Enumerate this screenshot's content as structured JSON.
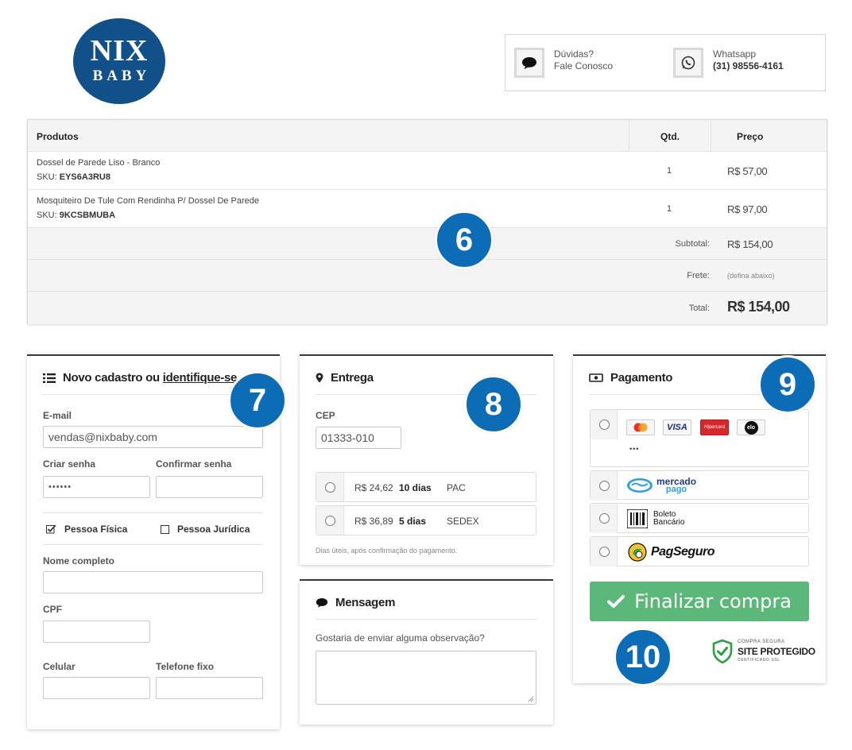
{
  "logo": {
    "line1": "NIX",
    "line2": "BABY"
  },
  "header": {
    "contact": {
      "line1": "Dúvidas?",
      "line2": "Fale Conosco",
      "icon": "chat-bubble-icon"
    },
    "whatsapp": {
      "line1": "Whatsapp",
      "line2": "(31) 98556-4161",
      "icon": "whatsapp-icon"
    }
  },
  "products": {
    "headers": {
      "product": "Produtos",
      "qty": "Qtd.",
      "price": "Preço"
    },
    "rows": [
      {
        "name": "Dossel de Parede Liso - Branco",
        "sku_label": "SKU:",
        "sku": "EYS6A3RU8",
        "qty": "1",
        "price": "R$ 57,00"
      },
      {
        "name": "Mosquiteiro De Tule Com Rendinha P/ Dossel De Parede",
        "sku_label": "SKU:",
        "sku": "9KCSBMUBA",
        "qty": "1",
        "price": "R$ 97,00"
      }
    ],
    "subtotal_label": "Subtotal:",
    "subtotal_value": "R$ 154,00",
    "frete_label": "Frete:",
    "frete_value": "(defina abaixo)",
    "total_label": "Total:",
    "total_value": "R$ 154,00"
  },
  "badges": {
    "b6": "6",
    "b7": "7",
    "b8": "8",
    "b9": "9",
    "b10": "10"
  },
  "cadastro": {
    "title_prefix": "Novo cadastro ou",
    "title_link": "identifique-se",
    "email_label": "E-mail",
    "email_value": "vendas@nixbaby.com",
    "senha_label": "Criar senha",
    "senha_value": "••••••",
    "confirmar_label": "Confirmar senha",
    "pessoa_fisica": "Pessoa Física",
    "pessoa_juridica": "Pessoa Jurídica",
    "nome_label": "Nome completo",
    "cpf_label": "CPF",
    "celular_label": "Celular",
    "telefone_label": "Telefone fixo"
  },
  "entrega": {
    "title": "Entrega",
    "cep_label": "CEP",
    "cep_value": "01333-010",
    "options": [
      {
        "price": "R$ 24,62",
        "days": "10 dias",
        "service": "PAC"
      },
      {
        "price": "R$ 36,89",
        "days": "5 dias",
        "service": "SEDEX"
      }
    ],
    "note": "Dias úteis, após confirmação do pagamento."
  },
  "mensagem": {
    "title": "Mensagem",
    "prompt": "Gostaria de enviar alguma observação?"
  },
  "pagamento": {
    "title": "Pagamento",
    "cards": {
      "visa": "VISA",
      "hipercard": "Hipercard",
      "elo": "elo",
      "more": "•••"
    },
    "mercadopago": {
      "line1": "mercado",
      "line2": "pago"
    },
    "boleto": {
      "line1": "Boleto",
      "line2": "Bancário"
    },
    "pagseguro": "PagSeguro",
    "finalizar": "Finalizar compra",
    "ssl": {
      "line1": "COMPRA SEGURA",
      "line2": "SITE PROTEGIDO",
      "line3": "CERTIFICADO SSL"
    }
  },
  "colors": {
    "brand": "#115089",
    "badge": "#0c6db6",
    "finalizar": "#5cb87a",
    "ssl_shield": "#2e9e45"
  }
}
